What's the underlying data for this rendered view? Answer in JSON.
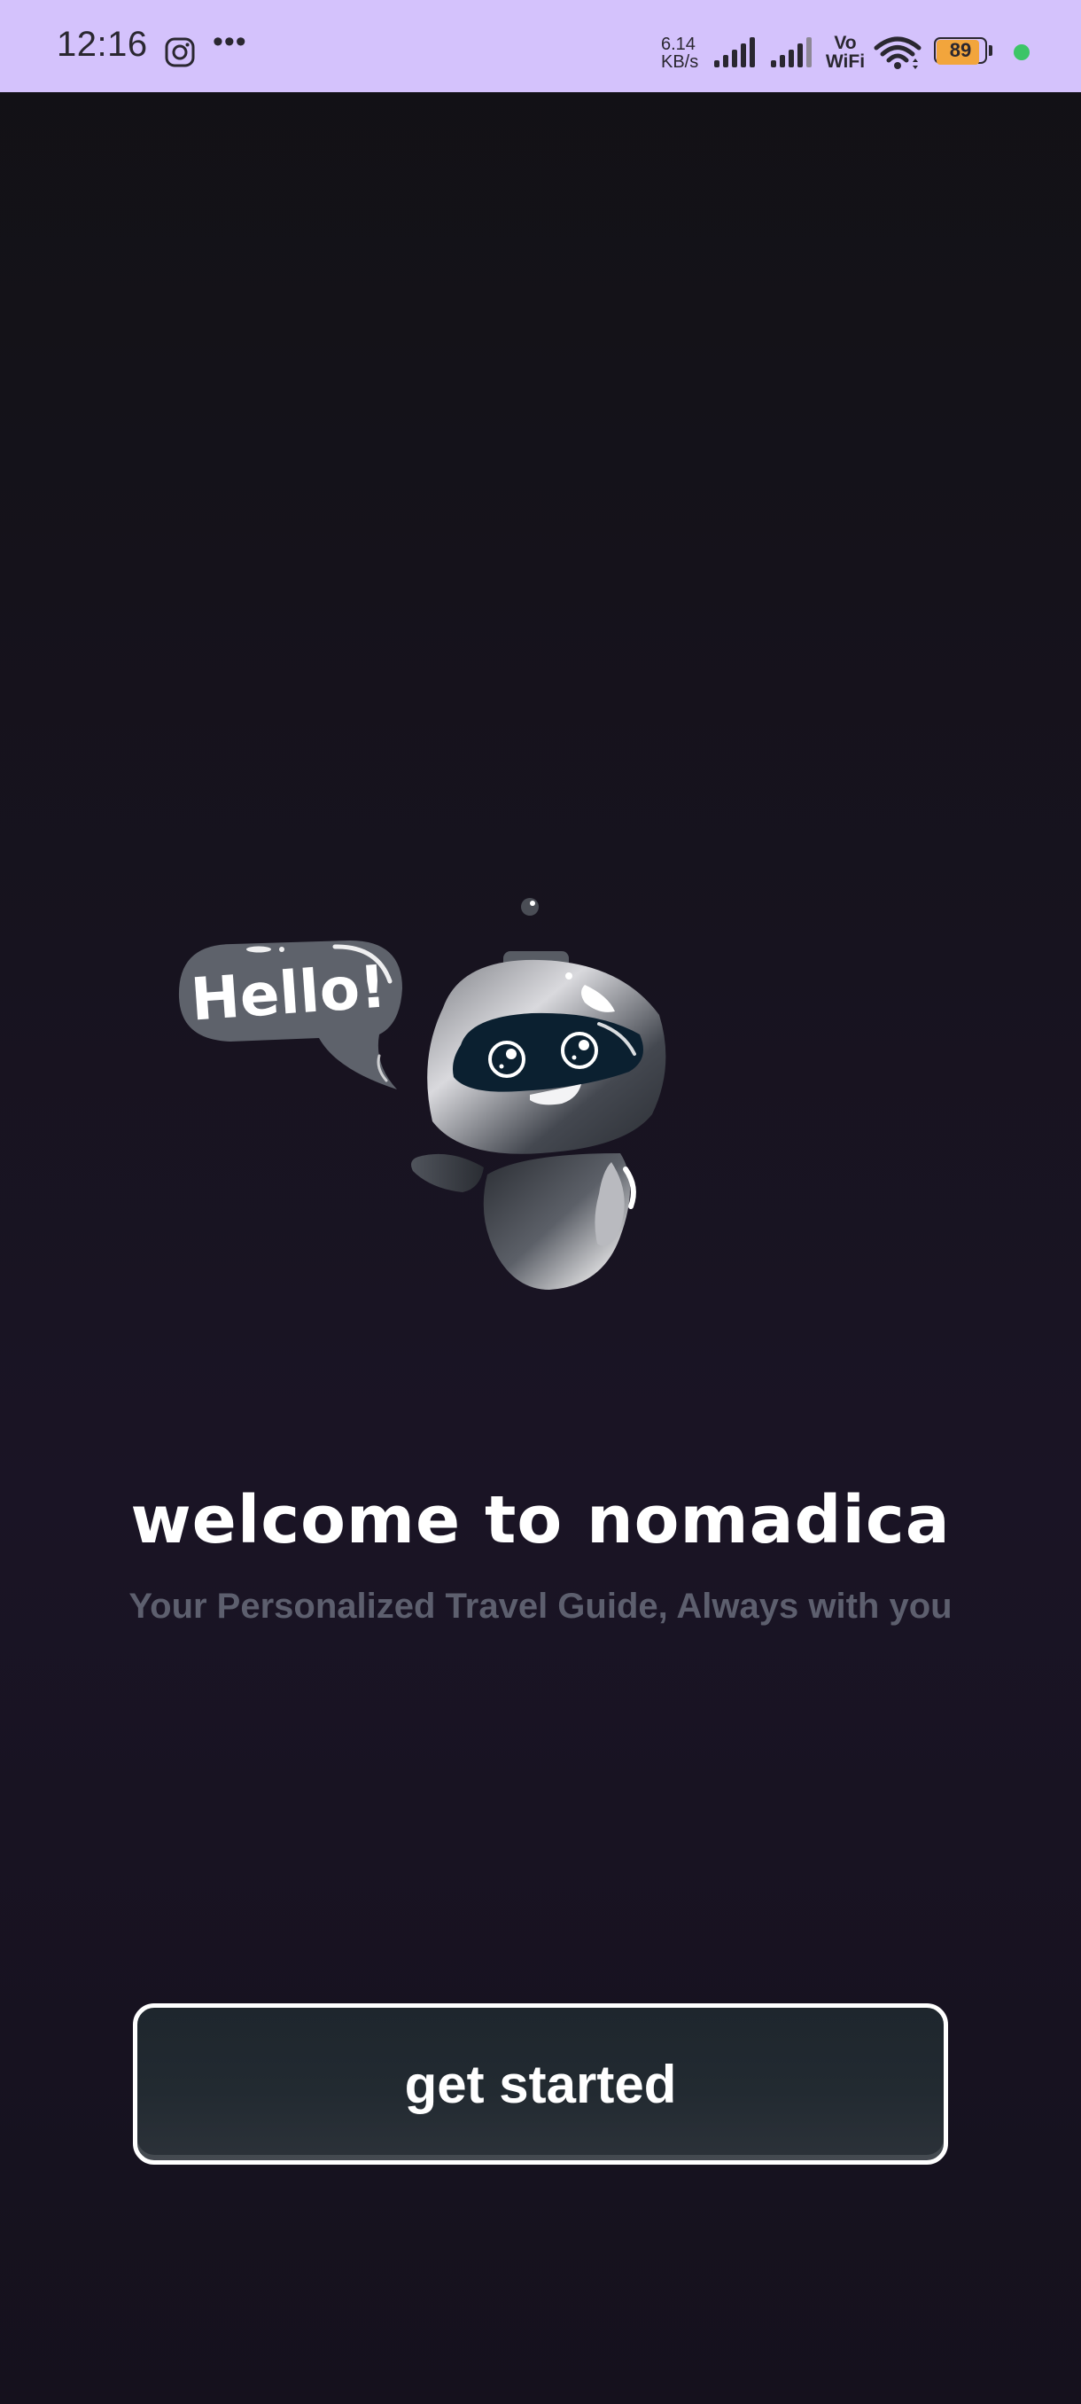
{
  "status_bar": {
    "time": "12:16",
    "network_speed_value": "6.14",
    "network_speed_unit": "KB/s",
    "vowifi_line1": "Vo",
    "vowifi_line2": "WiFi",
    "battery_level": 89,
    "battery_label": "89",
    "icons": [
      "instagram-icon",
      "more-icon",
      "signal-icon",
      "signal-icon",
      "wifi-icon",
      "battery-icon",
      "privacy-dot"
    ],
    "colors": {
      "background": "#d4c2fc",
      "battery_fill": "#f2a53c",
      "dot": "#3cc567"
    }
  },
  "mascot": {
    "speech_bubble_text": "Hello!"
  },
  "welcome": {
    "title": "welcome to nomadica",
    "subtitle": "Your Personalized Travel Guide, Always with you"
  },
  "actions": {
    "get_started_label": "get started"
  }
}
